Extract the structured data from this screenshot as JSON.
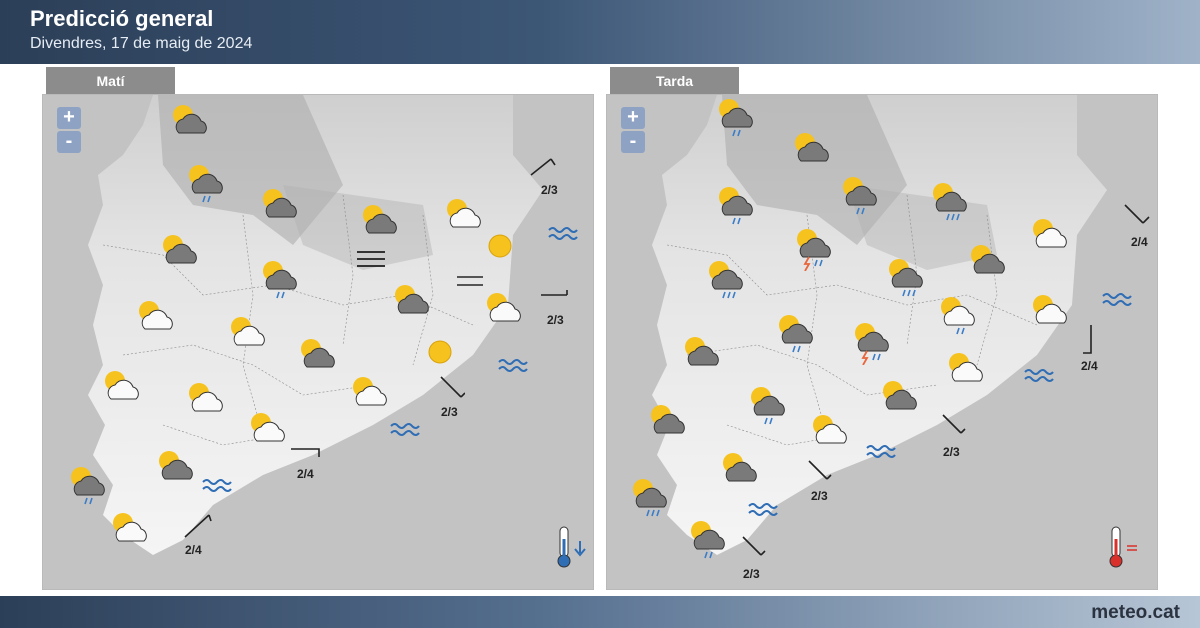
{
  "header": {
    "title": "Predicció general",
    "subtitle": "Divendres, 17 de maig de 2024"
  },
  "footer": {
    "logo_name": "meteo",
    "logo_tld": ".cat"
  },
  "zoom": {
    "plus": "+",
    "minus": "-"
  },
  "panels": [
    {
      "tab": "Matí",
      "wind": [
        "2/3",
        "2/3",
        "2/3",
        "2/4",
        "2/4"
      ],
      "thermometer_trend": "arrow-down-icon"
    },
    {
      "tab": "Tarda",
      "wind": [
        "2/4",
        "2/4",
        "2/3",
        "2/3",
        "2/3"
      ],
      "thermometer_trend": "equal-icon"
    }
  ],
  "colors": {
    "header_dark": "#2c3f58",
    "header_light": "#9fb2c8",
    "tab": "#8c8c8c",
    "zoom": "#8ea3c4",
    "sea_icon": "#2f6db5",
    "rain": "#3a7dc8",
    "lightning": "#e8663c",
    "sun": "#f6c21d"
  }
}
